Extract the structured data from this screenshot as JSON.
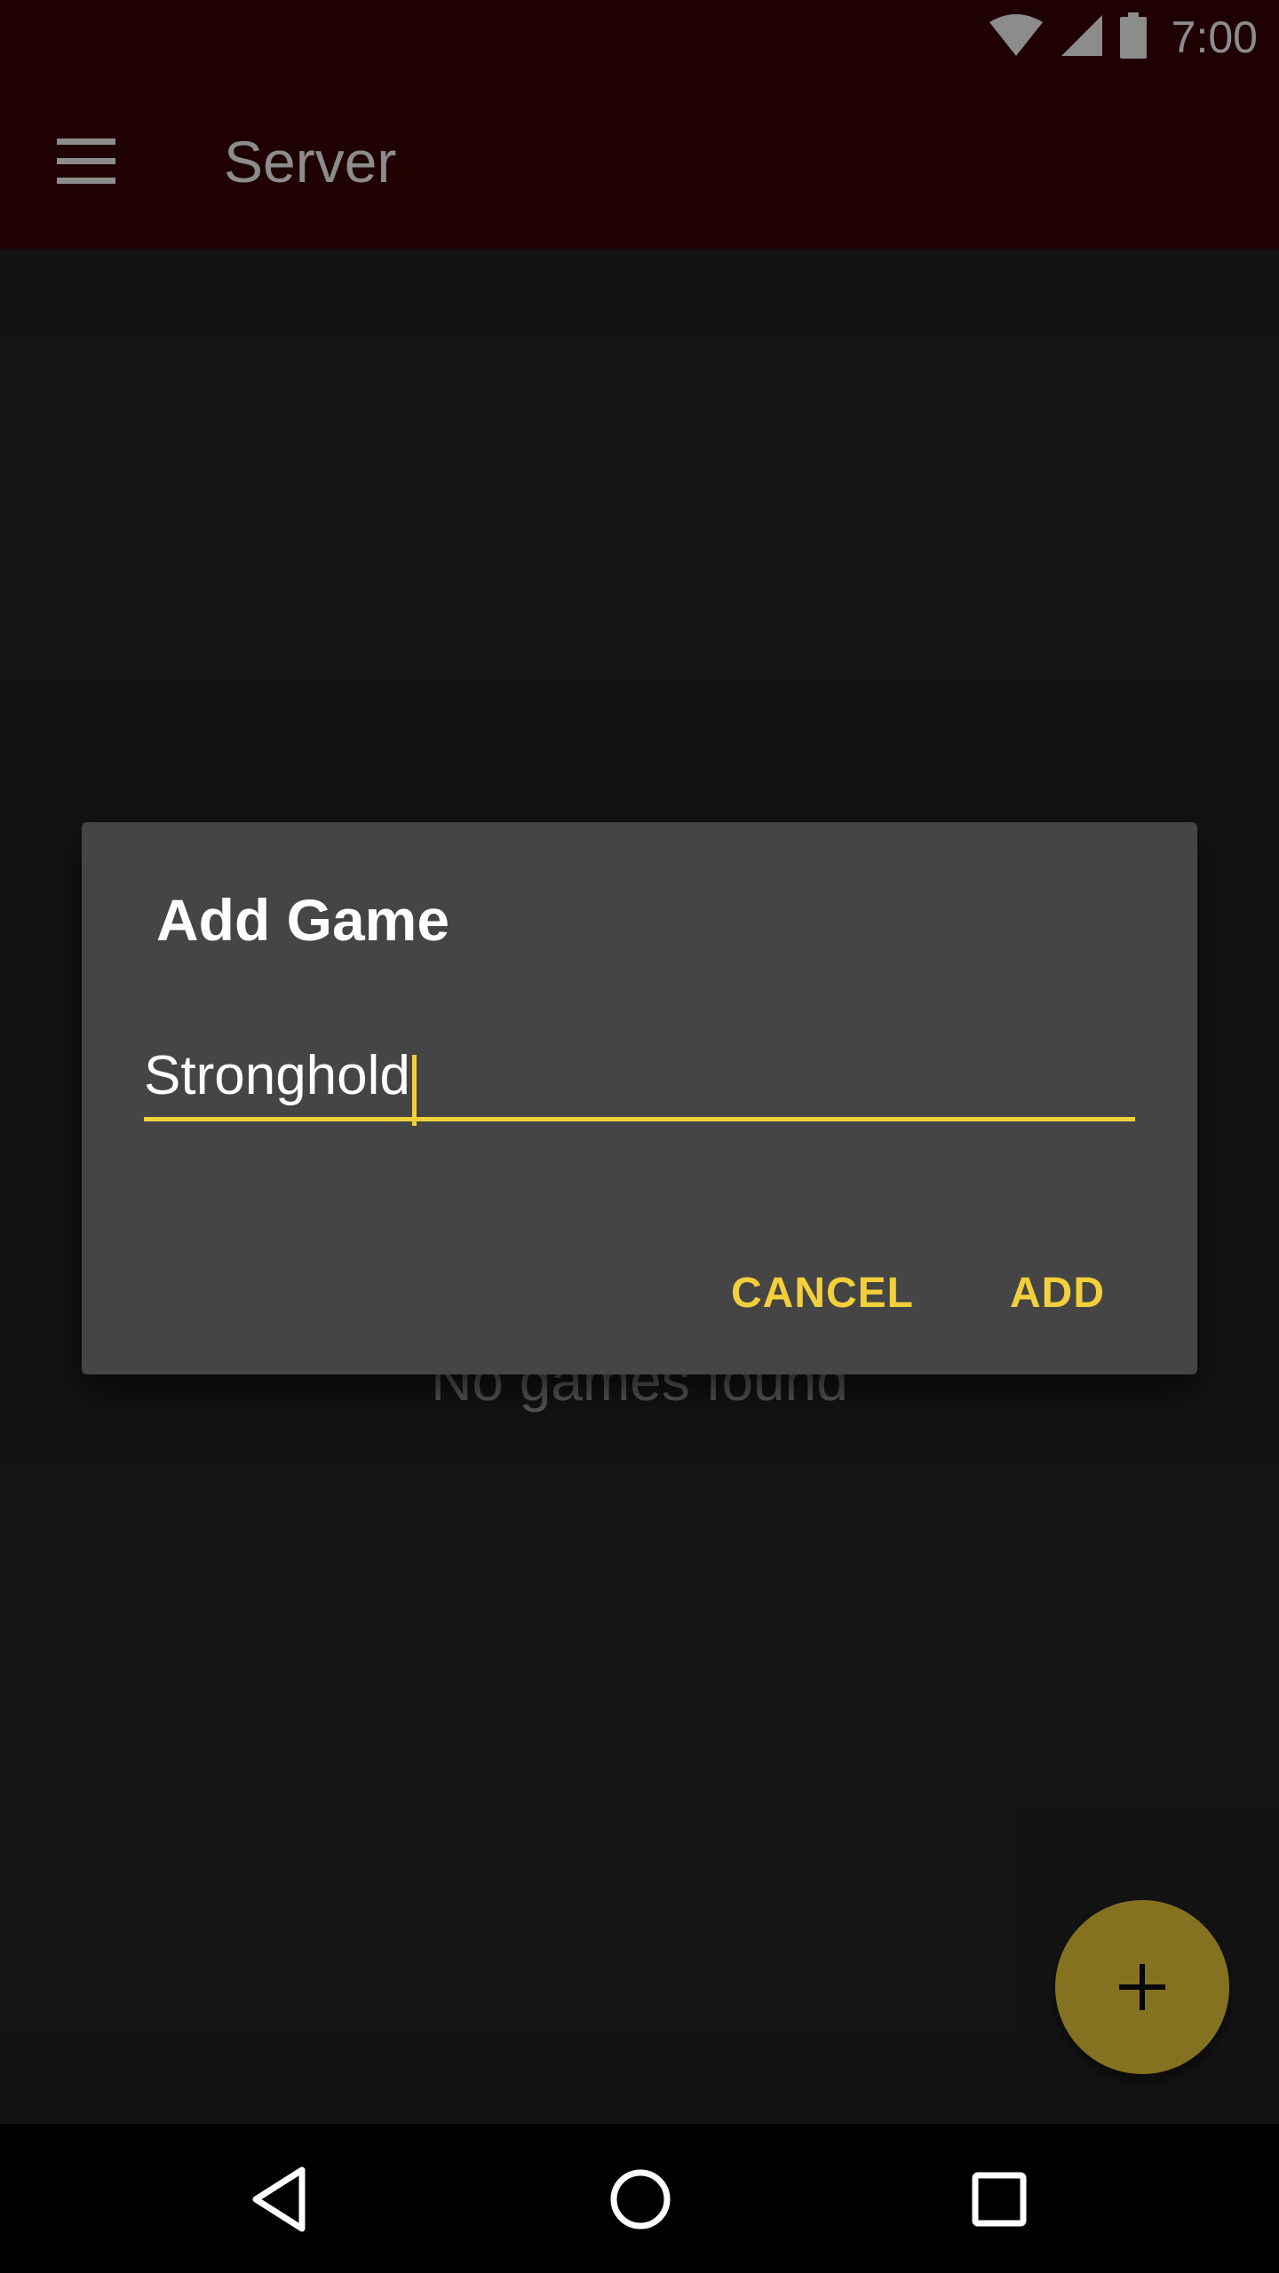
{
  "status_bar": {
    "time": "7:00",
    "icons": [
      "wifi-icon",
      "cellular-signal-icon",
      "battery-icon"
    ]
  },
  "app_bar": {
    "title": "Server",
    "menu_icon": "menu-icon"
  },
  "content": {
    "empty_text": "No games found"
  },
  "fab": {
    "icon": "plus-icon"
  },
  "dialog": {
    "title": "Add Game",
    "field_value": "Stronghold",
    "cancel_label": "CANCEL",
    "add_label": "ADD"
  },
  "nav_bar": {
    "icons": [
      "back-icon",
      "home-icon",
      "recents-icon"
    ]
  },
  "colors": {
    "primary_dark": "#3a0204",
    "accent": "#f3d03b",
    "background": "#242424",
    "dialog_background": "#454545"
  }
}
